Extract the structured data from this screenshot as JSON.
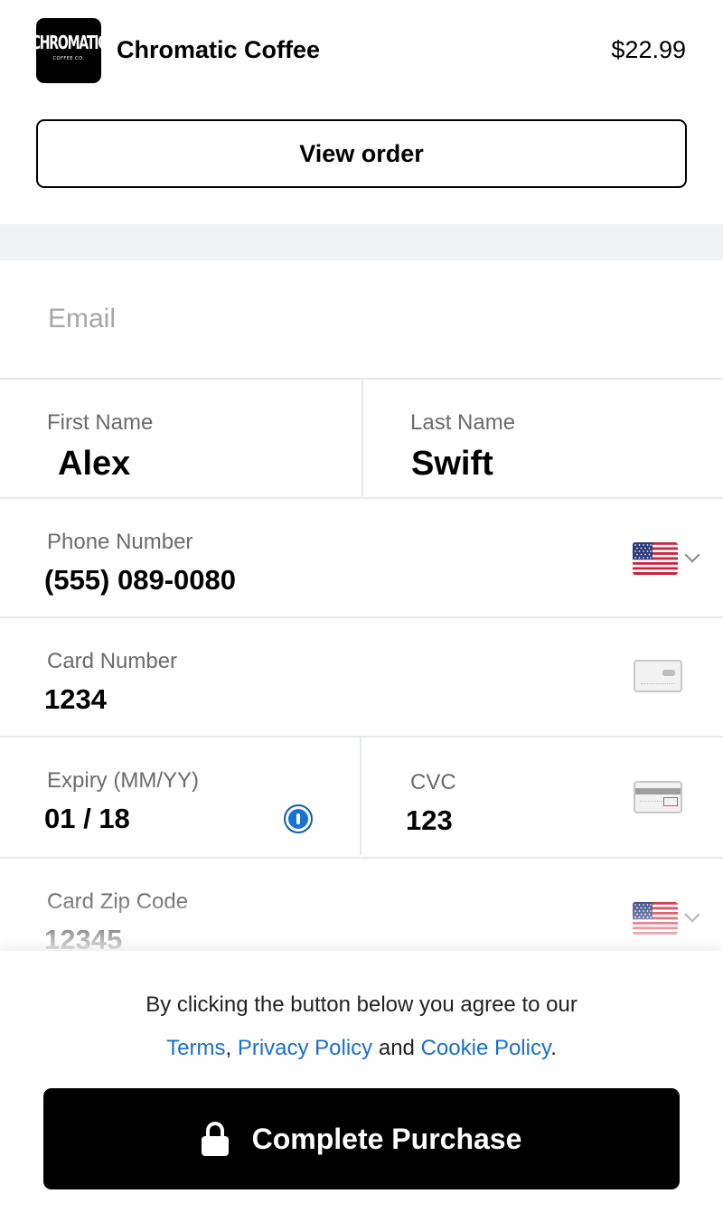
{
  "header": {
    "logo_text": "CHROMATIC",
    "logo_subtext": "COFFEE CO.",
    "store_name": "Chromatic Coffee",
    "price": "$22.99"
  },
  "view_order_label": "View order",
  "form": {
    "email": {
      "placeholder": "Email",
      "value": ""
    },
    "first_name": {
      "label": "First Name",
      "value": "Alex"
    },
    "last_name": {
      "label": "Last Name",
      "value": "Swift"
    },
    "phone": {
      "label": "Phone Number",
      "value": "(555) 089-0080",
      "country_icon": "us-flag-icon"
    },
    "card_number": {
      "label": "Card Number",
      "value": "1234",
      "icon": "card-icon"
    },
    "expiry": {
      "label": "Expiry (MM/YY)",
      "value": "01 / 18",
      "autofill_icon": "password-manager-icon"
    },
    "cvc": {
      "label": "CVC",
      "value": "123",
      "icon": "card-back-icon"
    },
    "zip": {
      "label": "Card Zip Code",
      "value": "12345",
      "country_icon": "us-flag-icon"
    }
  },
  "agreement": {
    "line1": "By clicking the button below you agree to our",
    "terms": "Terms",
    "comma": ",",
    "privacy": "Privacy Policy",
    "and": "and",
    "cookie": "Cookie Policy",
    "period": "."
  },
  "purchase_label": "Complete Purchase",
  "colors": {
    "link": "#1a6fd1",
    "divider_band": "#eef2f5",
    "button_bg": "#000000",
    "label": "#6b6b6b"
  }
}
